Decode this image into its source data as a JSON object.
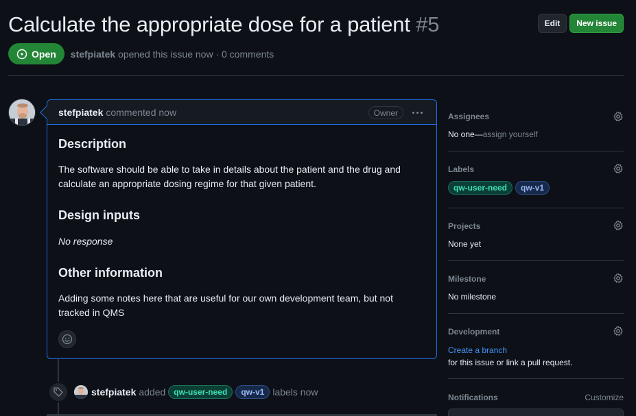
{
  "header": {
    "title": "Calculate the appropriate dose for a patient",
    "number": "#5",
    "edit_label": "Edit",
    "new_issue_label": "New issue"
  },
  "status": {
    "state": "Open",
    "author": "stefpiatek",
    "summary": "opened this issue now · 0 comments"
  },
  "comment": {
    "author": "stefpiatek",
    "time": "commented now",
    "badge": "Owner",
    "sections": [
      {
        "heading": "Description",
        "text": "The software should be able to take in details about the patient and the drug and calculate an appropriate dosing regime for that given patient."
      },
      {
        "heading": "Design inputs",
        "text": "No response"
      },
      {
        "heading": "Other information",
        "text": "Adding some notes here that are useful for our own development team, but not tracked in QMS"
      }
    ]
  },
  "event": {
    "author": "stefpiatek",
    "action": "added",
    "labels": [
      "qw-user-need",
      "qw-v1"
    ],
    "suffix": "labels now"
  },
  "sidebar": {
    "assignees": {
      "heading": "Assignees",
      "value_prefix": "No one—",
      "value_link": "assign yourself"
    },
    "labels": {
      "heading": "Labels",
      "items": [
        "qw-user-need",
        "qw-v1"
      ]
    },
    "projects": {
      "heading": "Projects",
      "value": "None yet"
    },
    "milestone": {
      "heading": "Milestone",
      "value": "No milestone"
    },
    "development": {
      "heading": "Development",
      "link": "Create a branch",
      "value": "for this issue or link a pull request."
    },
    "notifications": {
      "heading": "Notifications",
      "customize": "Customize"
    }
  },
  "colors": {
    "background": "#0d1117",
    "open_green": "#238636",
    "accent_blue": "#1f6feb",
    "link_blue": "#4493f8",
    "label_user_need": "#3fe0b5",
    "label_v1": "#9bb8f2"
  }
}
